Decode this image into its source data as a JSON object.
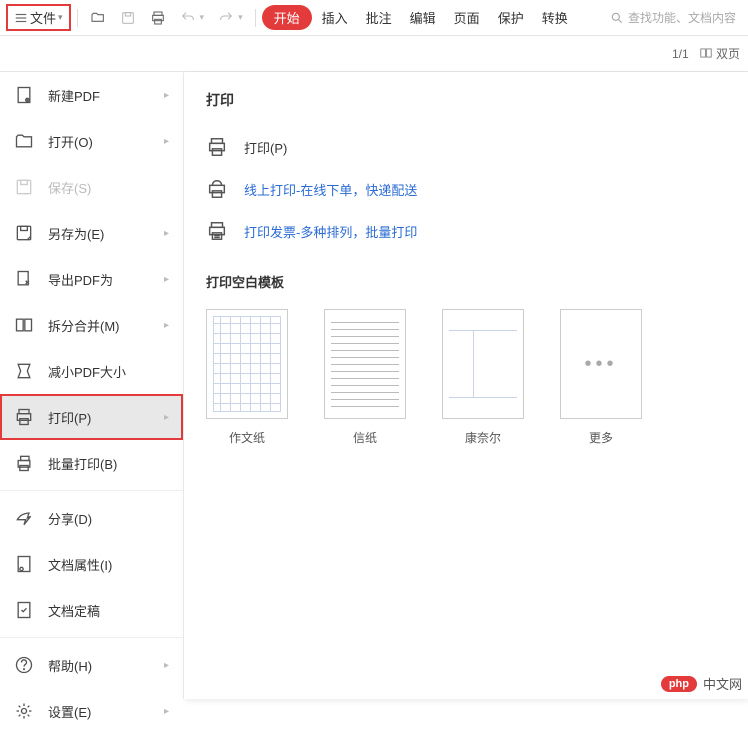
{
  "toolbar": {
    "file_label": "文件",
    "tabs": {
      "start": "开始",
      "insert": "插入",
      "comment": "批注",
      "edit": "编辑",
      "page": "页面",
      "protect": "保护",
      "convert": "转换"
    },
    "search_placeholder": "查找功能、文档内容"
  },
  "subbar": {
    "page_indicator": "1/1",
    "view_mode": "双页"
  },
  "file_menu": [
    {
      "id": "new-pdf",
      "label": "新建PDF",
      "has_sub": true
    },
    {
      "id": "open",
      "label": "打开(O)",
      "has_sub": true
    },
    {
      "id": "save",
      "label": "保存(S)",
      "has_sub": false,
      "disabled": true
    },
    {
      "id": "save-as",
      "label": "另存为(E)",
      "has_sub": true
    },
    {
      "id": "export-pdf",
      "label": "导出PDF为",
      "has_sub": true
    },
    {
      "id": "split-merge",
      "label": "拆分合并(M)",
      "has_sub": true
    },
    {
      "id": "reduce-size",
      "label": "减小PDF大小",
      "has_sub": false
    },
    {
      "id": "print",
      "label": "打印(P)",
      "has_sub": true,
      "highlighted": true,
      "boxed": true
    },
    {
      "id": "batch-print",
      "label": "批量打印(B)",
      "has_sub": false
    },
    {
      "id": "share",
      "label": "分享(D)",
      "has_sub": false,
      "sep_before": true
    },
    {
      "id": "doc-props",
      "label": "文档属性(I)",
      "has_sub": false
    },
    {
      "id": "finalize",
      "label": "文档定稿",
      "has_sub": false
    },
    {
      "id": "help",
      "label": "帮助(H)",
      "has_sub": true,
      "sep_before": true
    },
    {
      "id": "settings",
      "label": "设置(E)",
      "has_sub": true
    }
  ],
  "print_panel": {
    "heading": "打印",
    "items": {
      "print_label": "打印(P)",
      "online_print_label": "线上打印-在线下单，快递配送",
      "invoice_print_label": "打印发票-多种排列，批量打印"
    },
    "template_heading": "打印空白模板",
    "templates": {
      "composition": "作文纸",
      "letter": "信纸",
      "cornell": "康奈尔",
      "more": "更多"
    }
  },
  "watermark": {
    "badge": "php",
    "text": "中文网"
  }
}
